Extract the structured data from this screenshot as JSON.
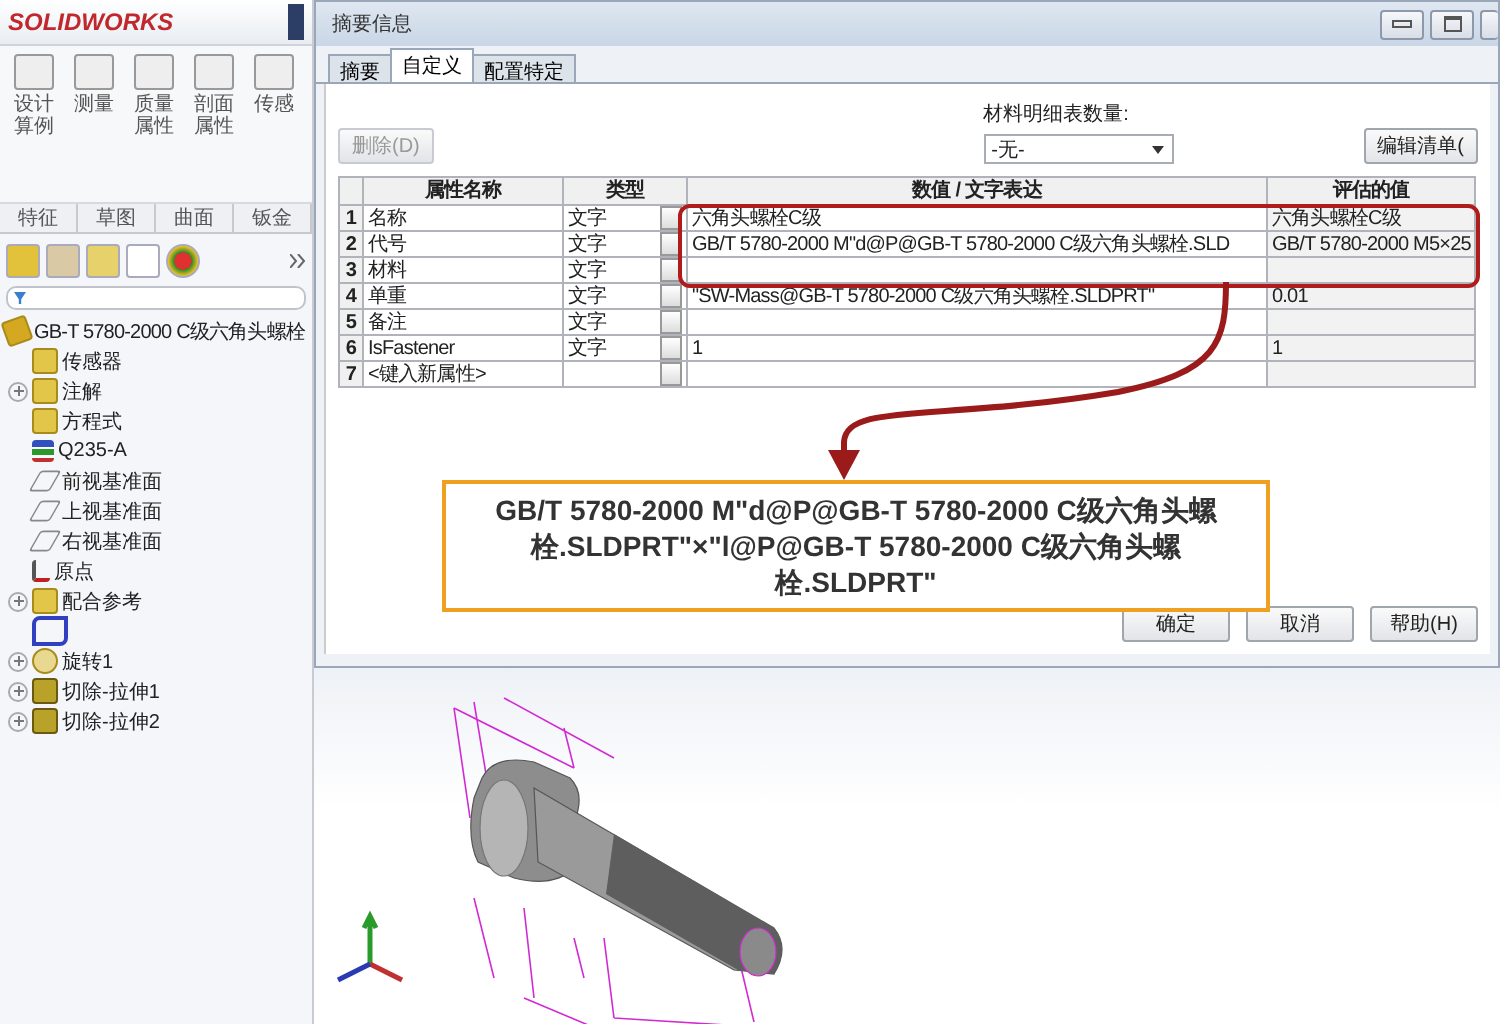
{
  "app": {
    "logo": "SOLIDWORKS"
  },
  "toolbar": {
    "buttons": [
      {
        "label": "设计算例"
      },
      {
        "label": "测量"
      },
      {
        "label": "质量属性"
      },
      {
        "label": "剖面属性"
      },
      {
        "label": "传感"
      }
    ]
  },
  "command_tabs": [
    {
      "label": "特征",
      "selected": false
    },
    {
      "label": "草图",
      "selected": false
    },
    {
      "label": "曲面",
      "selected": false
    },
    {
      "label": "钣金",
      "selected": false
    }
  ],
  "feature_tree": {
    "root": {
      "label": "GB-T 5780-2000 C级六角头螺栓",
      "kind": "part",
      "children": [
        {
          "label": "传感器",
          "kind": "sensor",
          "expandable": false
        },
        {
          "label": "注解",
          "kind": "annotation",
          "expandable": true
        },
        {
          "label": "方程式",
          "kind": "equation",
          "expandable": false
        },
        {
          "label": "Q235-A",
          "kind": "material",
          "expandable": false
        },
        {
          "label": "前视基准面",
          "kind": "plane",
          "expandable": false
        },
        {
          "label": "上视基准面",
          "kind": "plane",
          "expandable": false
        },
        {
          "label": "右视基准面",
          "kind": "plane",
          "expandable": false
        },
        {
          "label": "原点",
          "kind": "origin",
          "expandable": false
        },
        {
          "label": "配合参考",
          "kind": "mate",
          "expandable": true
        },
        {
          "kind": "sketch",
          "expandable": false
        },
        {
          "label": "旋转1",
          "kind": "revolve",
          "expandable": true
        },
        {
          "label": "切除-拉伸1",
          "kind": "cut",
          "expandable": true
        },
        {
          "label": "切除-拉伸2",
          "kind": "cut",
          "expandable": true
        }
      ]
    }
  },
  "dialog": {
    "title": "摘要信息",
    "tabs": [
      {
        "label": "摘要",
        "selected": false
      },
      {
        "label": "自定义",
        "selected": true
      },
      {
        "label": "配置特定",
        "selected": false
      }
    ],
    "delete_button": {
      "label": "删除(D)",
      "disabled": true
    },
    "bom_quantity": {
      "label": "材料明细表数量:",
      "value": "-无-"
    },
    "edit_list_button": {
      "label": "编辑清单("
    },
    "table": {
      "columns": [
        "属性名称",
        "类型",
        "数值 / 文字表达",
        "评估的值"
      ],
      "rows": [
        {
          "index": "1",
          "name": "名称",
          "type": "文字",
          "value": "六角头螺栓C级",
          "evaluated": "六角头螺栓C级"
        },
        {
          "index": "2",
          "name": "代号",
          "type": "文字",
          "value": "GB/T 5780-2000 M\"d@P@GB-T 5780-2000 C级六角头螺栓.SLD",
          "evaluated": "GB/T 5780-2000 M5×25"
        },
        {
          "index": "3",
          "name": "材料",
          "type": "文字"
        },
        {
          "index": "4",
          "name": "单重",
          "type": "文字",
          "value": "\"SW-Mass@GB-T 5780-2000 C级六角头螺栓.SLDPRT\"",
          "evaluated": "0.01"
        },
        {
          "index": "5",
          "name": "备注",
          "type": "文字"
        },
        {
          "index": "6",
          "name": "IsFastener",
          "type": "文字",
          "value": "1",
          "evaluated": "1"
        },
        {
          "index": "7",
          "name": "<键入新属性>"
        }
      ]
    },
    "buttons": [
      {
        "label": "确定"
      },
      {
        "label": "取消"
      },
      {
        "label": "帮助(H)"
      }
    ]
  },
  "callout": {
    "text": "GB/T 5780-2000 M\"d@P@GB-T 5780-2000 C级六角头螺栓.SLDPRT\"×\"l@P@GB-T 5780-2000 C级六角头螺栓.SLDPRT\""
  }
}
